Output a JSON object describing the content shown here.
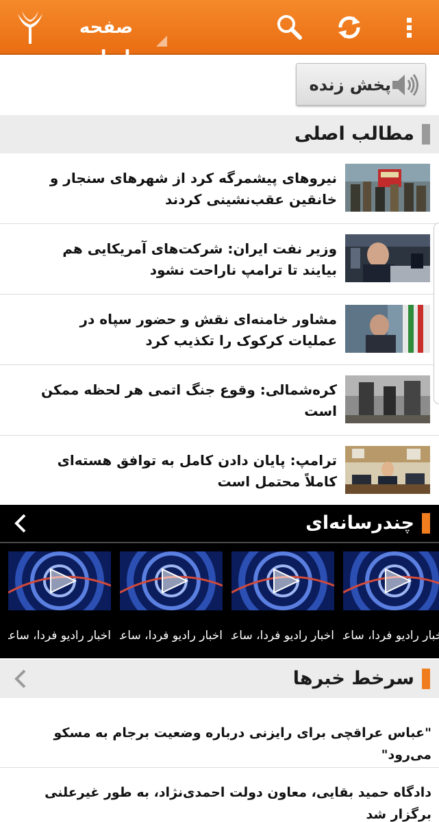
{
  "app": {
    "title": "صفحه اصلی",
    "accent_color": "#f07d1e",
    "icons": [
      "rfe-torch-logo",
      "search-icon",
      "refresh-icon",
      "overflow-menu-icon"
    ]
  },
  "live": {
    "label": "پخش زنده",
    "icon": "speaker-icon"
  },
  "top_stories": {
    "title": "مطالب اصلی",
    "items": [
      {
        "headline": "نیروهای پیشمرگه کرد از شهرهای سنجار و خانقین عقب‌نشینی کردند"
      },
      {
        "headline": "وزیر نفت ایران: شرکت‌های آمریکایی هم بیایند تا ترامپ ناراحت نشود"
      },
      {
        "headline": "مشاور خامنه‌ای نقش و حضور سپاه در عملیات کرکوک را تکذیب کرد"
      },
      {
        "headline": "کره‌شمالی: وقوع جنگ اتمی هر لحظه ممکن است"
      },
      {
        "headline": "ترامپ: پایان دادن کامل به توافق هسته‌ای کاملاً محتمل است"
      }
    ]
  },
  "multimedia": {
    "title": "چندرسانه‌ای",
    "items": [
      {
        "caption": "اخبار رادیو فردا، ساعت"
      },
      {
        "caption": "اخبار رادیو فردا، ساعت"
      },
      {
        "caption": "اخبار رادیو فردا، ساعت"
      },
      {
        "caption": "اخبار رادیو فردا، ساعت"
      }
    ]
  },
  "headlines": {
    "title": "سرخط خبرها",
    "items": [
      {
        "text": "\"عباس عراقچی برای رایزنی درباره وضعیت برجام به مسکو می‌رود\""
      },
      {
        "text": "دادگاه حمید بقایی، معاون دولت احمدی‌نژاد، به طور غیرعلنی برگزار شد"
      }
    ]
  }
}
